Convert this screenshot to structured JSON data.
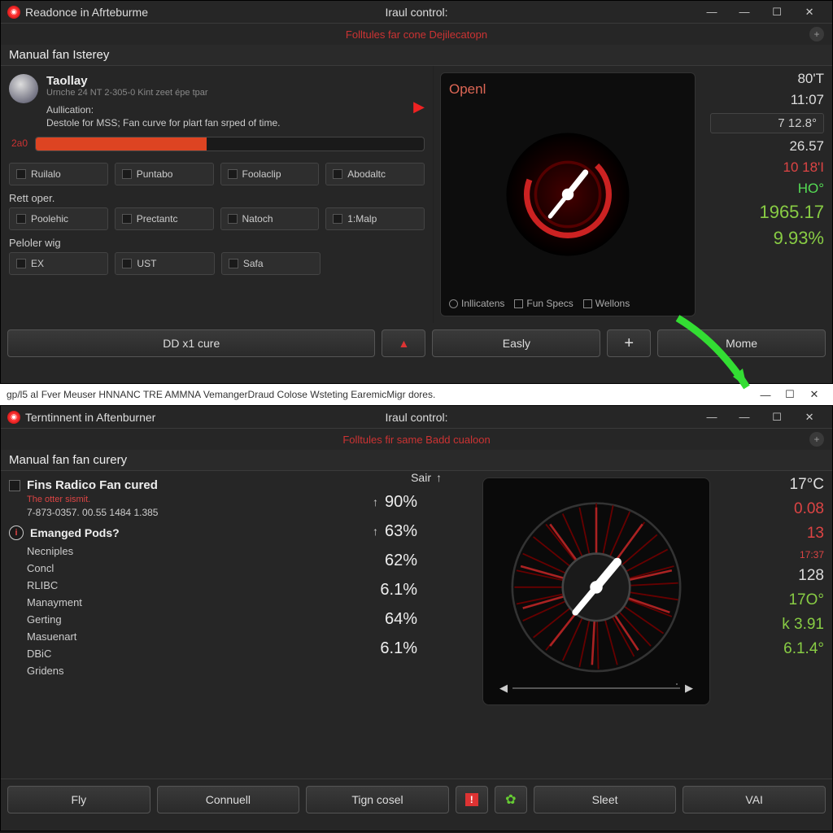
{
  "w1": {
    "title_left": "Readonce in Afrteburme",
    "title_center": "Iraul control:",
    "subbar": "Folltules far cone Dejilecatopn",
    "section": "Manual fan Isterey",
    "profile": {
      "name": "Taollay",
      "sub": "Urnche 24 NT 2-305-0 Kint zeet épe tpar",
      "line1": "Aullication:",
      "line2": "Destole for MSS; Fan curve for plart fan srped of time."
    },
    "progress_label": "2a0",
    "row1": [
      "Ruilalo",
      "Puntabo",
      "Foolaclip",
      "Abodaltc"
    ],
    "row1_label": "Rett oper.",
    "row2": [
      "Poolehic",
      "Prectantc",
      "Natoch",
      "1:Malp"
    ],
    "row2_label": "Peloler wig",
    "row3": [
      "EX",
      "UST",
      "Safa"
    ],
    "primary_btn": "DD x1 cure",
    "gauge_label": "Openl",
    "checks": [
      "Inllicatens",
      "Fun Specs",
      "Wellons"
    ],
    "btns": {
      "a": "▲",
      "b": "Easly",
      "c": "+",
      "d": "Mome"
    },
    "stats": [
      {
        "v": "80'T",
        "cls": ""
      },
      {
        "v": "11:07",
        "cls": ""
      },
      {
        "v": "7 12.8°",
        "cls": "",
        "boxed": true
      },
      {
        "v": "26.57",
        "cls": ""
      },
      {
        "v": "10 18'I",
        "cls": "red"
      },
      {
        "v": "HO°",
        "cls": "brightgreen"
      },
      {
        "v": "1965.17",
        "cls": "green",
        "big": true
      },
      {
        "v": "9.93%",
        "cls": "green",
        "big": true
      }
    ]
  },
  "whitebar": "gp/l5 aI Fver Meuser HNNANC TRE AMMNA VemangerDraud Colose Wsteting EaremicMigr dores.",
  "w2": {
    "title_left": "Terntinnent in Aftenburner",
    "title_center": "Iraul control:",
    "subbar": "Folltules fir same Badd cualoon",
    "section": "Manual fan fan curery",
    "list_header": "Fins Radico Fan cured",
    "list_sub": "The otter sismit.",
    "list_sub2": "7-873-0357. 00.55 1484 1.385",
    "list_sub3": "Emanged Pods?",
    "items": [
      "Necniples",
      "Concl",
      "RLIBC",
      "Manayment",
      "Gerting",
      "Masuenart",
      "DBiC",
      "Gridens"
    ],
    "sair": "Sair",
    "pcts": [
      "90%",
      "63%",
      "62%",
      "6.1%",
      "64%",
      "6.1%"
    ],
    "stats": [
      {
        "v": "17°C",
        "cls": ""
      },
      {
        "v": "0.08",
        "cls": "red"
      },
      {
        "v": "13",
        "cls": "red"
      },
      {
        "v": "17:37",
        "cls": "red",
        "small": true
      },
      {
        "v": "128",
        "cls": ""
      },
      {
        "v": "17O°",
        "cls": "green"
      },
      {
        "v": "k 3.91",
        "cls": "green"
      },
      {
        "v": "6.1.4°",
        "cls": "green"
      }
    ],
    "btns": [
      "Fly",
      "Connuell",
      "Tign cosel",
      "Sleet",
      "VAI"
    ]
  }
}
